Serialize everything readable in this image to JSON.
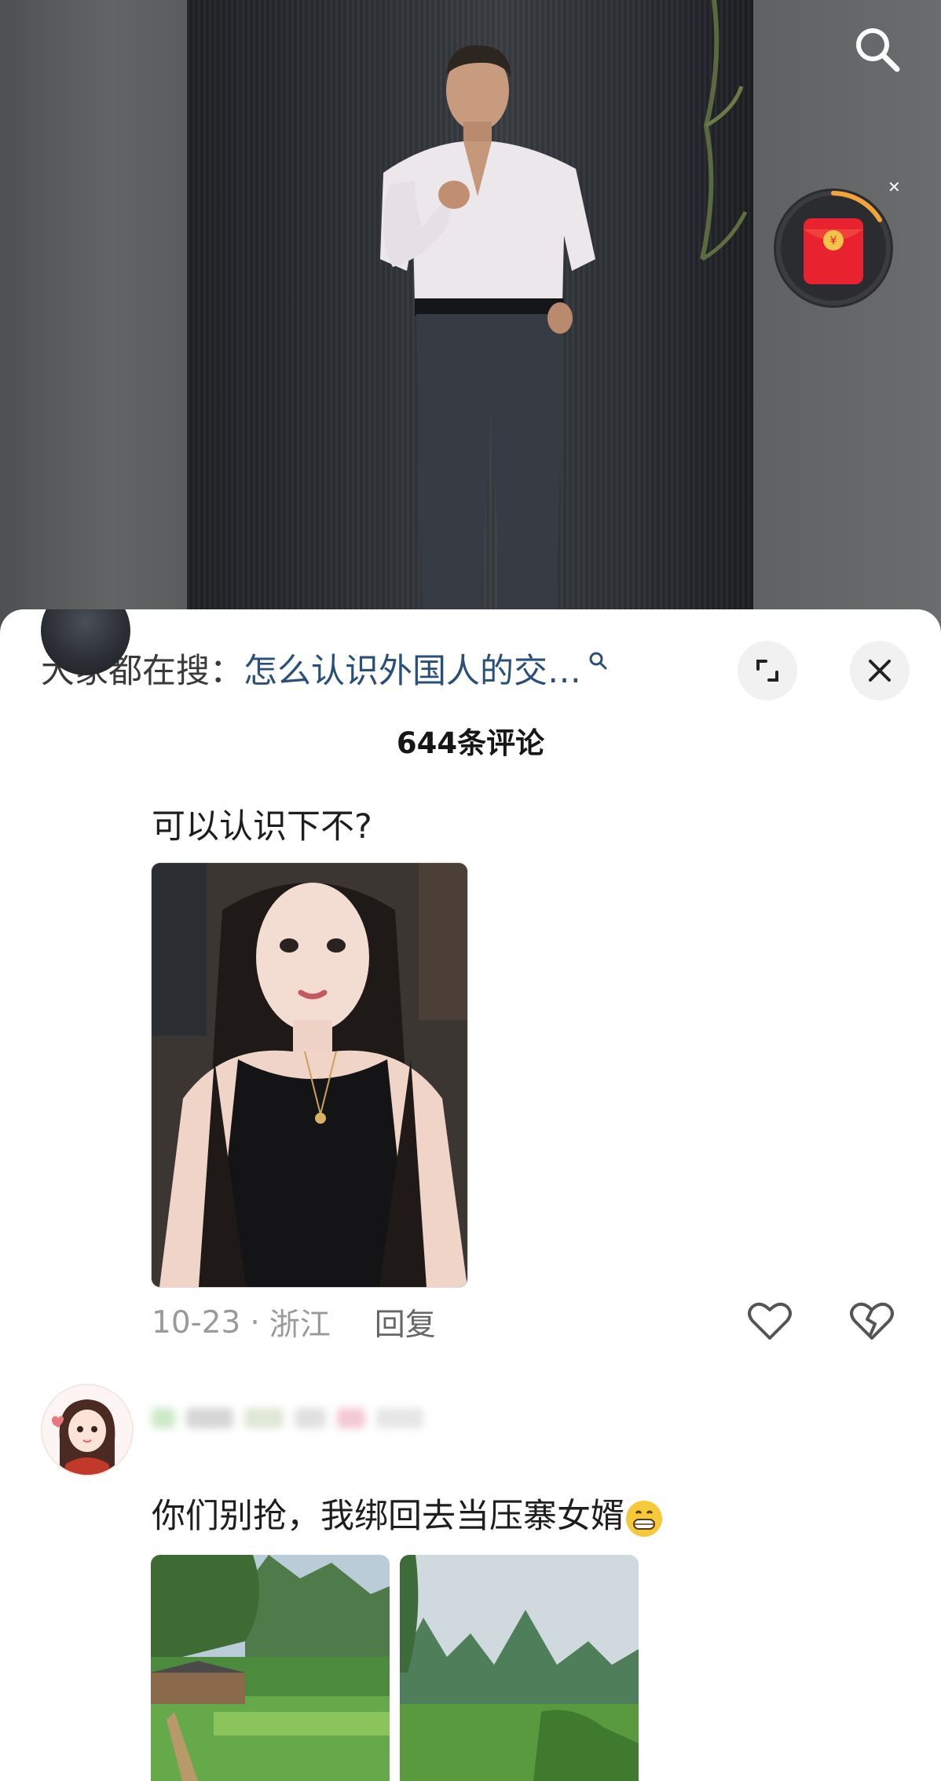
{
  "search_bar": {
    "prefix": "大家都在搜：",
    "query": "怎么认识外国人的交…"
  },
  "comments_header": {
    "count_label": "644条评论"
  },
  "comments": [
    {
      "text": "可以认识下不?",
      "date": "10-23",
      "separator": "·",
      "location": "浙江",
      "reply_label": "回复"
    },
    {
      "text": "你们别抢，我绑回去当压寨女婿"
    }
  ],
  "icons": {
    "search": "search-icon",
    "red_packet": "red-packet-icon",
    "expand": "expand-icon",
    "close": "close-icon",
    "like": "heart-icon",
    "dislike": "broken-heart-icon",
    "emoji": "grin-emoji"
  },
  "colors": {
    "search_query": "#2a4f7a",
    "red_packet": "#e8232f",
    "timer_ring": "#f2a43a"
  }
}
